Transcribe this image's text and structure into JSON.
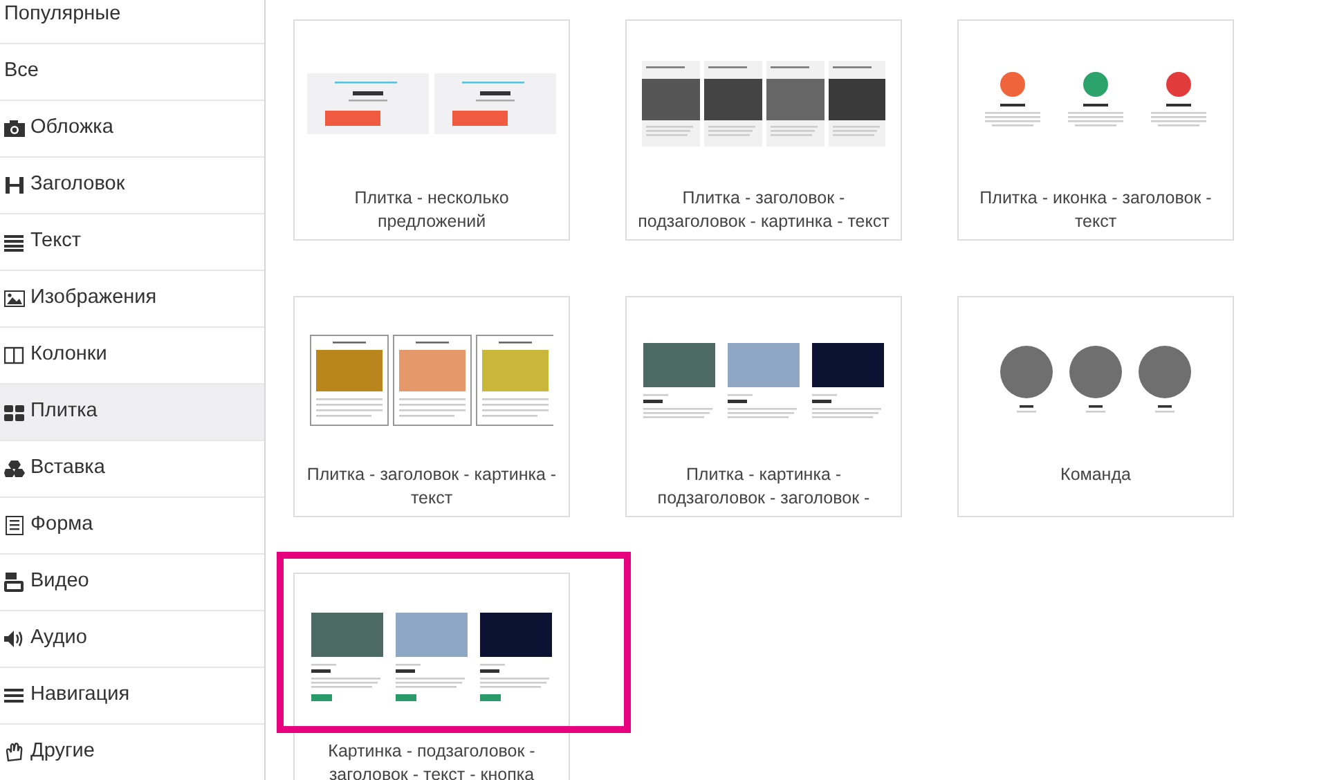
{
  "sidebar": {
    "items": [
      {
        "label": "Популярные",
        "selected": false
      },
      {
        "label": "Все",
        "selected": false
      },
      {
        "label": "Обложка",
        "selected": false
      },
      {
        "label": "Заголовок",
        "selected": false
      },
      {
        "label": "Текст",
        "selected": false
      },
      {
        "label": "Изображения",
        "selected": false
      },
      {
        "label": "Колонки",
        "selected": false
      },
      {
        "label": "Плитка",
        "selected": true
      },
      {
        "label": "Вставка",
        "selected": false
      },
      {
        "label": "Форма",
        "selected": false
      },
      {
        "label": "Видео",
        "selected": false
      },
      {
        "label": "Аудио",
        "selected": false
      },
      {
        "label": "Навигация",
        "selected": false
      },
      {
        "label": "Другие",
        "selected": false
      }
    ]
  },
  "templates": [
    {
      "kind": "offers",
      "caption": "Плитка - несколько предложений",
      "highlighted": false
    },
    {
      "kind": "people",
      "caption": "Плитка - заголовок - подзаголовок - картинка - текст",
      "highlighted": false
    },
    {
      "kind": "icons",
      "caption": "Плитка - иконка - заголовок - текст",
      "highlighted": false
    },
    {
      "kind": "tiles",
      "caption": "Плитка - заголовок - картинка - текст",
      "highlighted": false
    },
    {
      "kind": "cities",
      "caption": "Плитка - картинка - подзаголовок - заголовок -",
      "highlighted": false
    },
    {
      "kind": "team",
      "caption": "Команда",
      "highlighted": false
    },
    {
      "kind": "cities-button",
      "caption": "Картинка - подзаголовок - заголовок - текст - кнопка",
      "highlighted": true
    }
  ]
}
